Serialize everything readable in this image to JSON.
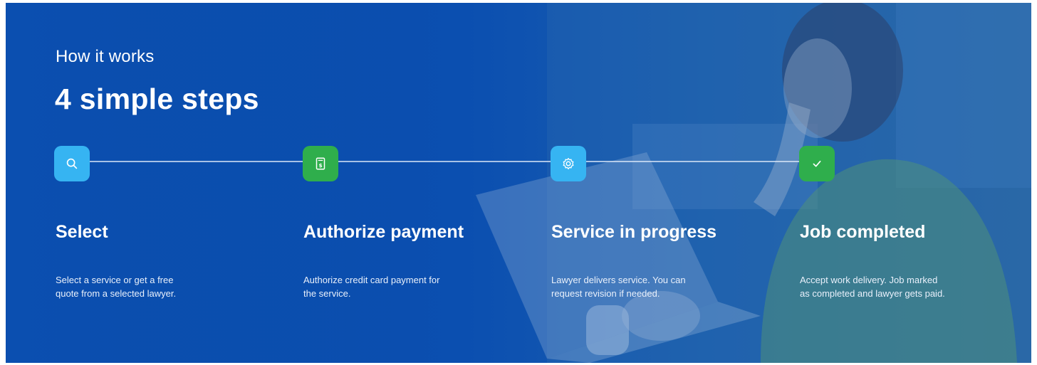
{
  "section": {
    "eyebrow": "How it works",
    "title": "4 simple steps"
  },
  "colors": {
    "background_primary": "#0b4fb0",
    "step_blue": "#36b4f2",
    "step_green": "#2fae4c",
    "text": "#ffffff"
  },
  "steps": [
    {
      "icon": "search-icon",
      "icon_color": "#36b4f2",
      "heading": "Select",
      "description_line1": "Select a service or get a free",
      "description_line2": "quote from a selected lawyer."
    },
    {
      "icon": "invoice-dollar-icon",
      "icon_color": "#2fae4c",
      "heading": "Authorize payment",
      "description_line1": "Authorize credit card payment for",
      "description_line2": "the service."
    },
    {
      "icon": "gear-icon",
      "icon_color": "#36b4f2",
      "heading": "Service in progress",
      "description_line1": "Lawyer delivers service. You can",
      "description_line2": "request revision if needed."
    },
    {
      "icon": "checkmark-icon",
      "icon_color": "#2fae4c",
      "heading": "Job completed",
      "description_line1": "Accept work delivery. Job marked",
      "description_line2": "as completed and lawyer gets paid."
    }
  ]
}
